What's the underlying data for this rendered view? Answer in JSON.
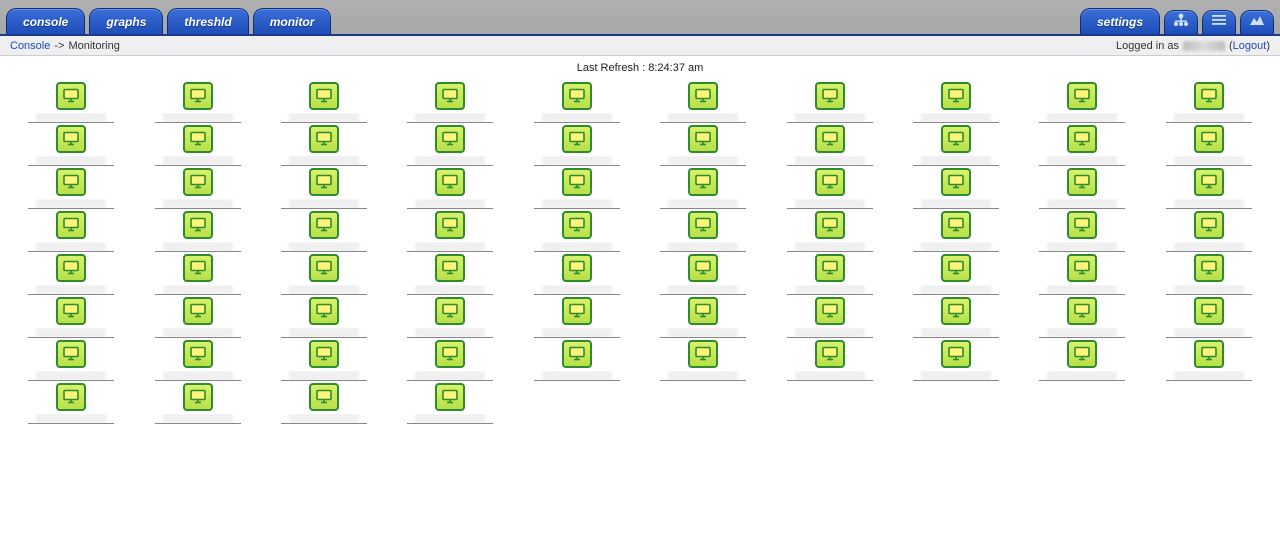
{
  "nav": {
    "tabs": [
      {
        "label": "console"
      },
      {
        "label": "graphs"
      },
      {
        "label": "threshld"
      },
      {
        "label": "monitor"
      }
    ],
    "settings_label": "settings",
    "icon_buttons": [
      {
        "name": "tree-icon"
      },
      {
        "name": "list-icon"
      },
      {
        "name": "preview-icon"
      }
    ]
  },
  "breadcrumb": {
    "root": "Console",
    "current": "Monitoring",
    "logged_in_prefix": "Logged in as",
    "logout_label": "Logout"
  },
  "refresh": {
    "prefix": "Last Refresh : ",
    "time": "8:24:37 am"
  },
  "grid": {
    "columns": 10,
    "host_count": 74
  }
}
